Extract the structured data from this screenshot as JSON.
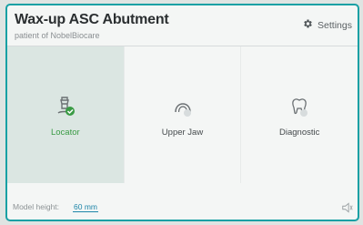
{
  "header": {
    "title": "Wax-up ASC Abutment",
    "subtitle": "patient of NobelBiocare",
    "settings_label": "Settings",
    "settings_icon": "gear-icon"
  },
  "tiles": [
    {
      "label": "Locator",
      "icon": "locator-abutment-icon",
      "selected": true,
      "badge": "check-icon"
    },
    {
      "label": "Upper Jaw",
      "icon": "upper-jaw-icon",
      "selected": false
    },
    {
      "label": "Diagnostic",
      "icon": "diagnostic-tooth-icon",
      "selected": false
    }
  ],
  "footer": {
    "model_height_label": "Model height:",
    "model_height_value": "60 mm",
    "speaker_icon": "speaker-icon"
  },
  "colors": {
    "accent": "#18a0a4",
    "selected_label": "#3a9b45",
    "link": "#1f86a9"
  }
}
